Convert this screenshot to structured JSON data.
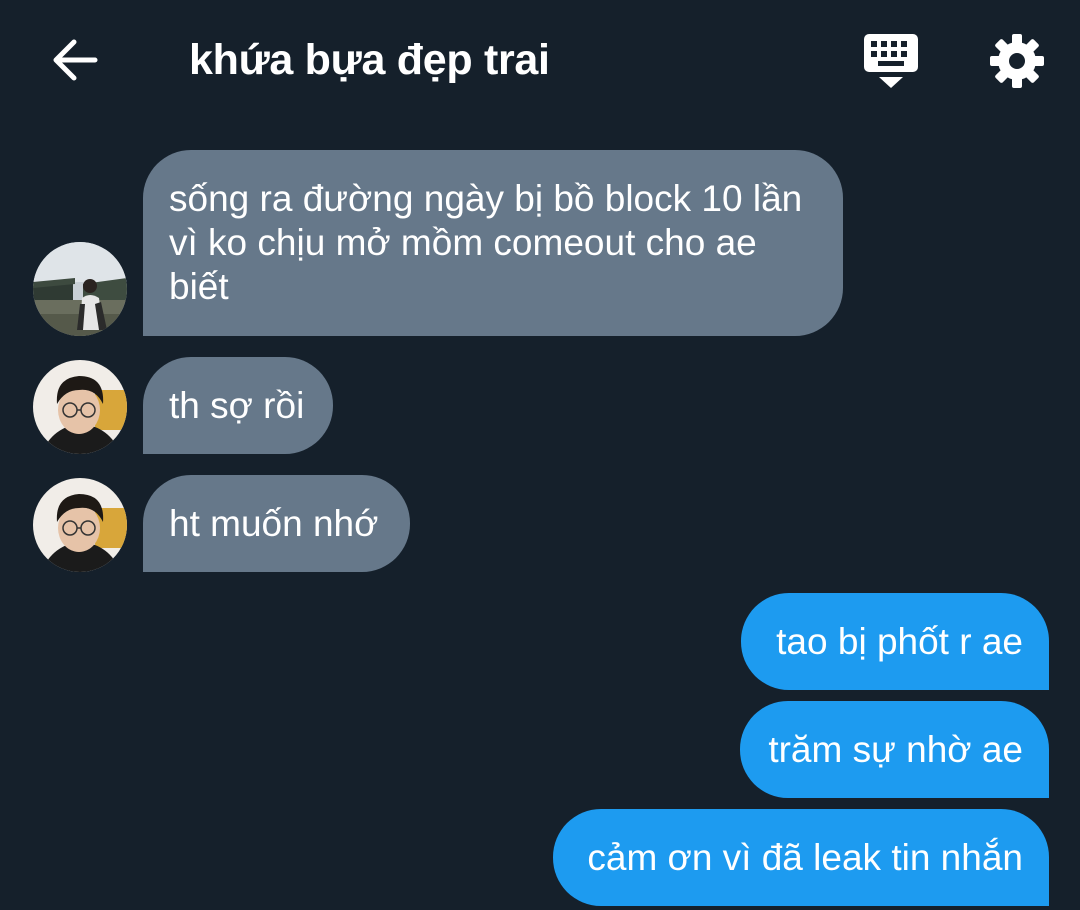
{
  "header": {
    "title": "khứa bựa đẹp trai",
    "back_icon": "arrow-left-icon",
    "keyboard_icon": "keyboard-icon",
    "settings_icon": "gear-icon"
  },
  "messages": [
    {
      "direction": "incoming",
      "text": "sống ra đường ngày bị bồ block 10 lần vì ko chịu mở mồm comeout cho ae biết"
    },
    {
      "direction": "incoming",
      "text": "th sợ rồi"
    },
    {
      "direction": "incoming",
      "text": "ht muốn nhớ"
    },
    {
      "direction": "outgoing",
      "text": "tao bị phốt r ae"
    },
    {
      "direction": "outgoing",
      "text": "trăm sự nhờ ae"
    },
    {
      "direction": "outgoing",
      "text": "cảm ơn vì đã leak tin nhắn"
    }
  ],
  "colors": {
    "background": "#15202b",
    "incoming_bubble": "#66788a",
    "outgoing_bubble": "#1d9bf0",
    "text": "#ffffff"
  }
}
